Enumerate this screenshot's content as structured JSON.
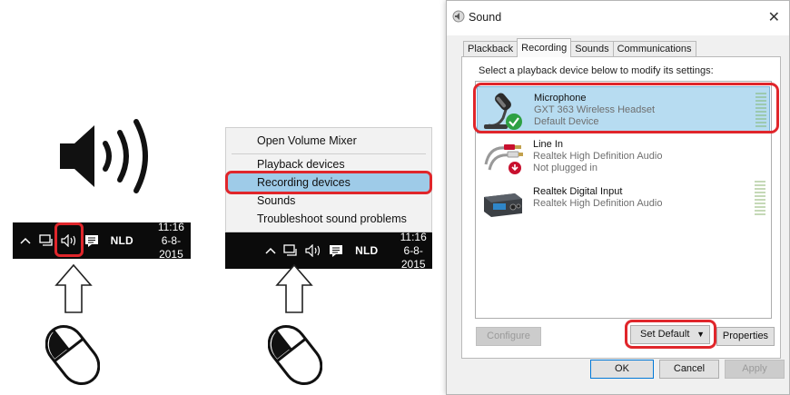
{
  "taskbar": {
    "lang": "NLD",
    "time": "11:16",
    "date": "6-8-2015"
  },
  "context_menu": {
    "items": [
      {
        "label": "Open Volume Mixer"
      },
      {
        "label": "Playback devices"
      },
      {
        "label": "Recording devices",
        "highlighted": true
      },
      {
        "label": "Sounds"
      },
      {
        "label": "Troubleshoot sound problems"
      }
    ]
  },
  "dialog": {
    "title": "Sound",
    "tabs": [
      "Plackback",
      "Recording",
      "Sounds",
      "Communications"
    ],
    "active_tab": "Recording",
    "instruction": "Select a playback device below to modify its settings:",
    "devices": [
      {
        "name": "Microphone",
        "line1": "GXT 363 Wireless Headset",
        "line2": "Default Device",
        "selected": true,
        "icon": "microphone-icon"
      },
      {
        "name": "Line In",
        "line1": "Realtek High Definition Audio",
        "line2": "Not plugged in",
        "selected": false,
        "icon": "line-in-cable-icon"
      },
      {
        "name": "Realtek Digital Input",
        "line1": "Realtek High Definition Audio",
        "line2": "",
        "selected": false,
        "icon": "digital-input-icon"
      }
    ],
    "buttons": {
      "configure": "Configure",
      "set_default": "Set Default",
      "properties": "Properties",
      "ok": "OK",
      "cancel": "Cancel",
      "apply": "Apply"
    }
  },
  "colors": {
    "highlight_ring": "#e0262b",
    "menu_highlight": "#9ecbe8",
    "selected_device": "#b7dcf1",
    "taskbar": "#0b0b0b"
  }
}
